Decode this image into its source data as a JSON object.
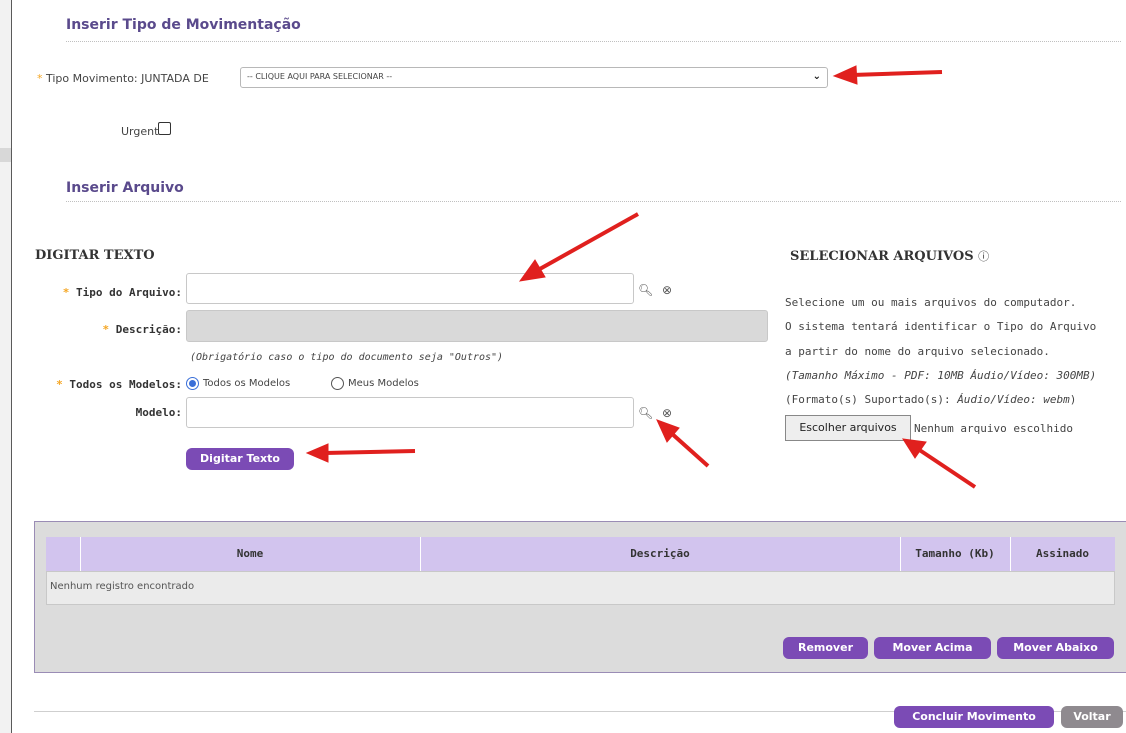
{
  "movement_section": {
    "title": "Inserir Tipo de Movimentação",
    "tipo_movimento_label": "Tipo Movimento:",
    "tipo_movimento_prefix": "JUNTADA DE",
    "tipo_movimento_select": "-- CLIQUE AQUI PARA SELECIONAR --",
    "urgente_label": "Urgente?",
    "required_marker": "*"
  },
  "file_section": {
    "title": "Inserir Arquivo"
  },
  "digitar_texto": {
    "heading": "DIGITAR TEXTO",
    "tipo_arquivo_label": "Tipo do Arquivo:",
    "tipo_arquivo_value": "",
    "descricao_label": "Descrição:",
    "descricao_value": "",
    "descricao_hint": "(Obrigatório caso o tipo do documento seja \"Outros\")",
    "todos_modelos_label": "Todos os Modelos:",
    "radio_todos": "Todos os Modelos",
    "radio_meus": "Meus Modelos",
    "radio_selected": "Todos os Modelos",
    "modelo_label": "Modelo:",
    "modelo_value": "",
    "button": "Digitar Texto",
    "search_icon": "search-icon",
    "clear_icon": "clear-icon"
  },
  "selecionar_arquivos": {
    "heading": "SELECIONAR ARQUIVOS",
    "help_icon": "help-icon",
    "line1": "Selecione um ou mais arquivos do computador.",
    "line2": "O sistema tentará identificar o Tipo do Arquivo",
    "line3": "a partir do nome do arquivo selecionado.",
    "line4": "(Tamanho Máximo - PDF: 10MB  Áudio/Vídeo: 300MB)",
    "line5_prefix": "(Formato(s) Suportado(s): ",
    "line5_value": "Áudio/Vídeo: webm",
    "line5_suffix": ")",
    "file_button": "Escolher arquivos",
    "file_status": "Nenhum arquivo escolhido"
  },
  "table": {
    "columns": [
      "",
      "Nome",
      "Descrição",
      "Tamanho (Kb)",
      "Assinado"
    ],
    "empty_message": "Nenhum registro encontrado",
    "buttons": {
      "remove": "Remover",
      "move_up": "Mover Acima",
      "move_down": "Mover Abaixo"
    }
  },
  "footer": {
    "conclude": "Concluir Movimento",
    "back": "Voltar"
  },
  "colors": {
    "accent": "#7b4bb5",
    "title": "#5a4a8c",
    "header": "#d2c4ee",
    "required": "#f5a623",
    "arrow": "#e0201e"
  }
}
